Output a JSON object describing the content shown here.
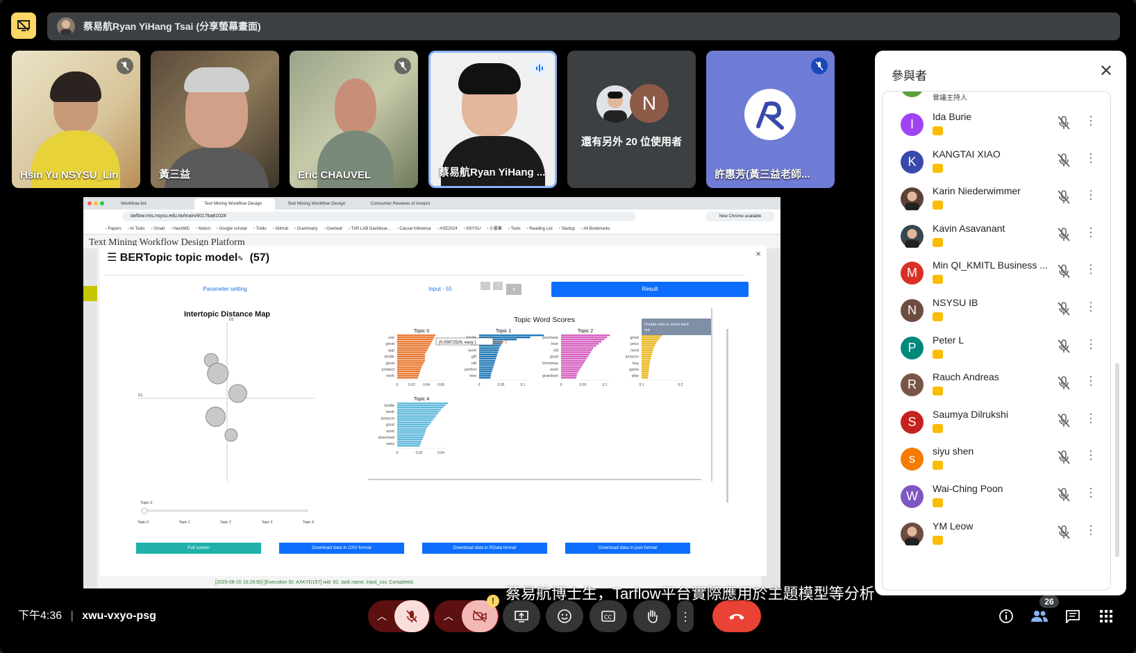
{
  "presenter": {
    "label": "蔡易航Ryan YiHang Tsai (分享螢幕畫面)"
  },
  "tiles": [
    {
      "name": "Hsin Yu NSYSU_Lin",
      "muted": true
    },
    {
      "name": "黃三益",
      "muted": false
    },
    {
      "name": "Eric CHAUVEL",
      "muted": true
    },
    {
      "name": "蔡易航Ryan YiHang ...",
      "muted": false,
      "speaking": true
    },
    {
      "name": "還有另外 20 位使用者",
      "avatar_letter": "N"
    },
    {
      "name": "許惠芳(黃三益老師...",
      "muted": true
    }
  ],
  "panel": {
    "title": "參與者",
    "partial_row": "曾議主持人",
    "participants": [
      {
        "name": "Ida Burie",
        "letter": "I",
        "color": "#a142f4"
      },
      {
        "name": "KANGTAI XIAO",
        "letter": "K",
        "color": "#3949ab"
      },
      {
        "name": "Karin Niederwimmer",
        "letter": "",
        "color": "#5d4037"
      },
      {
        "name": "Kavin Asavanant",
        "letter": "",
        "color": "#37474f"
      },
      {
        "name": "Min QI_KMITL Business ...",
        "letter": "M",
        "color": "#d93025"
      },
      {
        "name": "NSYSU IB",
        "letter": "N",
        "color": "#6d4c41"
      },
      {
        "name": "Peter L",
        "letter": "P",
        "color": "#00897b"
      },
      {
        "name": "Rauch Andreas",
        "letter": "R",
        "color": "#795548"
      },
      {
        "name": "Saumya Dilrukshi",
        "letter": "S",
        "color": "#c5221f"
      },
      {
        "name": "siyu shen",
        "letter": "s",
        "color": "#f57c00"
      },
      {
        "name": "Wai-Ching Poon",
        "letter": "W",
        "color": "#7e57c2"
      },
      {
        "name": "YM Leow",
        "letter": "",
        "color": "#6d4c41"
      }
    ]
  },
  "screen": {
    "tabs": [
      "Workflow-list",
      "Text Mining Workflow Design",
      "Text Mining Workflow Design",
      "Consumer Reviews of Amazo"
    ],
    "url": "tarflow.mis.nsysu.edu.tw/main/4017ba8102#",
    "chrome_notice": "New Chrome available",
    "bookmarks": [
      "Papers",
      "AI Tools",
      "Gmail",
      "HackMD",
      "Notion",
      "Google scholar",
      "Trello",
      "GitHub",
      "Grammarly",
      "Overleaf",
      "TAR LAB Dashboar...",
      "Causal Inference",
      "ASE2024",
      "NSYSU",
      "小畫筆",
      "Tools",
      "Reading List",
      "Startup",
      "All Bookmarks"
    ],
    "page_heading": "Text Mining Workflow Design Platform",
    "modal": {
      "title": "BERTopic topic model",
      "count": "(57)",
      "tabs": [
        "Parameter setting",
        "Input - 55",
        "Result"
      ],
      "distance_map_title": "Intertopic Distance Map",
      "axis_d1": "D1",
      "axis_d2": "D2",
      "slider_label": "Topic 0",
      "slider_ticks": [
        "Topic 0",
        "Topic 1",
        "Topic 2",
        "Topic 3",
        "Topic 4"
      ],
      "word_scores_title": "Topic Word Scores",
      "zoom_hint": "Double-click to zoom back out",
      "hover_label": "(0.05872526, easy )",
      "hover_trace": "trace 0",
      "buttons": [
        "Full screen",
        "Download data in CSV format",
        "Download data in RData format",
        "Download data in json format"
      ]
    },
    "status": "[2025-08-15 16:28:50] [Execution ID: AXKYD157] wid: 82, task name: input_csv, Completed."
  },
  "chart_data": [
    {
      "type": "bar",
      "title": "Topic 0",
      "categories": [
        "use",
        "great",
        "app",
        "kindle",
        "good",
        "product",
        "work"
      ],
      "values": [
        0.055,
        0.05,
        0.045,
        0.04,
        0.04,
        0.035,
        0.032
      ],
      "xticks": [
        "0",
        "0.02",
        "0.04",
        "0.06"
      ],
      "xlim": [
        0,
        0.07
      ],
      "color": "#e8772e"
    },
    {
      "type": "bar",
      "title": "Topic 1",
      "categories": [
        "kindle",
        "easy",
        "work",
        "gift",
        "old",
        "perfect",
        "new"
      ],
      "values": [
        0.16,
        0.059,
        0.05,
        0.045,
        0.04,
        0.035,
        0.03
      ],
      "xticks": [
        "0",
        "0.05",
        "0.1"
      ],
      "xlim": [
        0,
        0.12
      ],
      "color": "#1f77b4"
    },
    {
      "type": "bar",
      "title": "Topic 2",
      "categories": [
        "purchase",
        "love",
        "old",
        "good",
        "christmas",
        "work",
        "grandson"
      ],
      "values": [
        0.12,
        0.1,
        0.08,
        0.07,
        0.06,
        0.05,
        0.04
      ],
      "xticks": [
        "0",
        "0.05",
        "0.1"
      ],
      "xlim": [
        0,
        0.12
      ],
      "color": "#d45fc0"
    },
    {
      "type": "bar",
      "title": "Topic 3",
      "categories": [
        "great",
        "price",
        "need",
        "amazon",
        "buy",
        "game",
        "play"
      ],
      "values": [
        0.12,
        0.09,
        0.07,
        0.06,
        0.05,
        0.045,
        0.04
      ],
      "xticks": [
        "0.1",
        "0.2"
      ],
      "xlim": [
        0,
        0.25
      ],
      "color": "#e9b61e"
    },
    {
      "type": "bar",
      "title": "Topic 4",
      "categories": [
        "kindle",
        "book",
        "amazon",
        "good",
        "work",
        "download",
        "easy"
      ],
      "values": [
        0.052,
        0.045,
        0.04,
        0.035,
        0.03,
        0.028,
        0.025
      ],
      "xticks": [
        "0",
        "0.02",
        "0.04"
      ],
      "xlim": [
        0,
        0.05
      ],
      "color": "#5fb8db"
    },
    {
      "type": "scatter",
      "title": "Intertopic Distance Map",
      "points": [
        {
          "x": -0.35,
          "y": 0.85,
          "size": 10
        },
        {
          "x": -0.2,
          "y": 0.45,
          "size": 15
        },
        {
          "x": 0.25,
          "y": -0.15,
          "size": 13
        },
        {
          "x": -0.25,
          "y": -0.85,
          "size": 14
        },
        {
          "x": 0.1,
          "y": -1.4,
          "size": 9
        }
      ],
      "xlim": [
        -2,
        2
      ],
      "ylim": [
        -2.8,
        2
      ]
    }
  ],
  "bottom": {
    "time": "下午4:36",
    "separator": "|",
    "meeting_code": "xwu-vxyo-psg",
    "caption": "蔡易航博士生，Tarflow平台實際應用於主題模型等分析",
    "participant_count": "26"
  }
}
